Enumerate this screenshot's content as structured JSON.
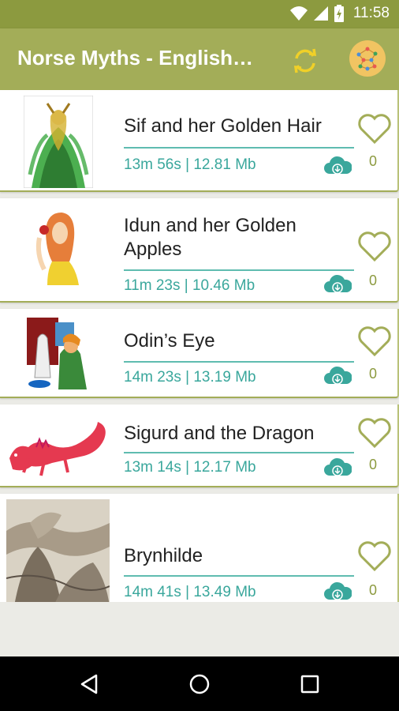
{
  "status_bar": {
    "time": "11:58",
    "icons": [
      "wifi-icon",
      "signal-icon",
      "battery-charging-icon"
    ]
  },
  "app_bar": {
    "title": "Norse Myths - English…",
    "actions": [
      "refresh-icon",
      "ball-icon"
    ]
  },
  "colors": {
    "status_bar": "#8c9a3f",
    "app_bar": "#a3ad58",
    "accent_teal": "#3aa79c",
    "heart": "#a3ad58",
    "refresh_icon": "#f0d028"
  },
  "stories": [
    {
      "title": "Sif and her Golden Hair",
      "meta": "13m 56s | 12.81 Mb",
      "likes": "0",
      "image": "sif-thumbnail"
    },
    {
      "title": "Idun and her Golden Apples",
      "meta": "11m 23s | 10.46 Mb",
      "likes": "0",
      "image": "idun-thumbnail"
    },
    {
      "title": "Odin’s Eye",
      "meta": "14m 23s | 13.19 Mb",
      "likes": "0",
      "image": "odin-thumbnail"
    },
    {
      "title": "Sigurd and the Dragon",
      "meta": "13m 14s | 12.17 Mb",
      "likes": "0",
      "image": "dragon-thumbnail"
    },
    {
      "title": "Brynhilde",
      "meta": "14m 41s | 13.49 Mb",
      "likes": "0",
      "image": "brynhilde-thumbnail"
    }
  ],
  "nav_bar": {
    "buttons": [
      "back-icon",
      "home-icon",
      "recents-icon"
    ]
  }
}
